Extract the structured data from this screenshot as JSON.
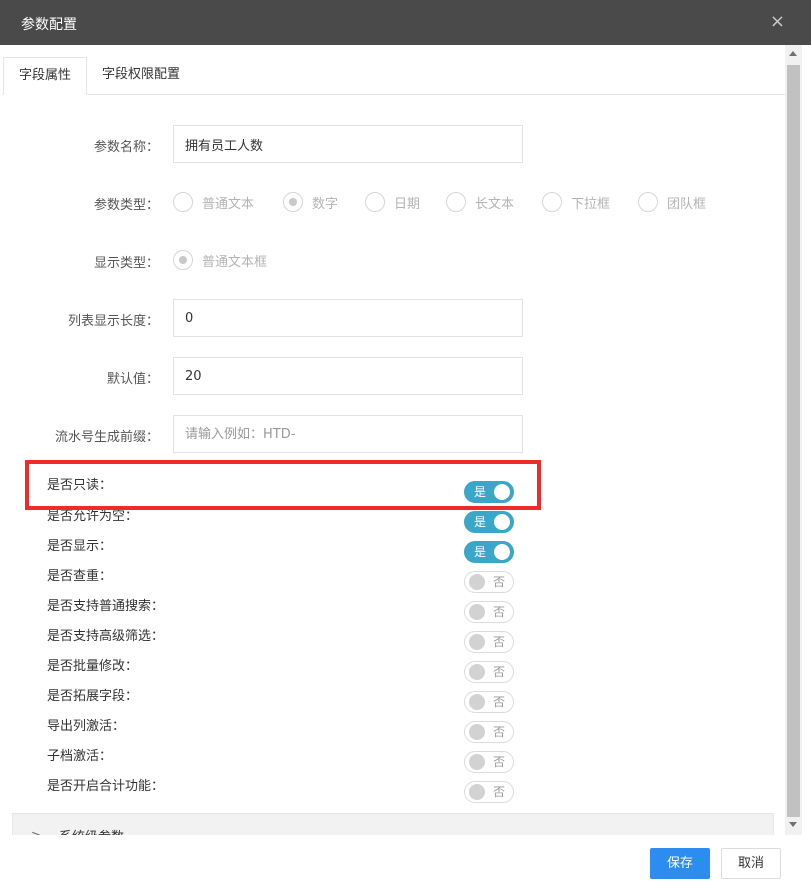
{
  "dialog": {
    "title": "参数配置",
    "close_label": "×"
  },
  "tabs": [
    {
      "label": "字段属性"
    },
    {
      "label": "字段权限配置"
    }
  ],
  "form": {
    "param_name": {
      "label": "参数名称：",
      "value": "拥有员工人数"
    },
    "param_type": {
      "label": "参数类型：",
      "options": [
        "普通文本",
        "数字",
        "日期",
        "长文本",
        "下拉框",
        "团队框"
      ],
      "selected": "数字"
    },
    "display_type": {
      "label": "显示类型：",
      "options": [
        "普通文本框"
      ],
      "selected": "普通文本框"
    },
    "list_length": {
      "label": "列表显示长度：",
      "value": "0"
    },
    "default_value": {
      "label": "默认值：",
      "value": "20"
    },
    "serial_prefix": {
      "label": "流水号生成前缀：",
      "value": "",
      "placeholder": "请输入例如：HTD-"
    }
  },
  "switches": [
    {
      "label": "是否只读：",
      "state": "是"
    },
    {
      "label": "是否允许为空：",
      "state": "是"
    },
    {
      "label": "是否显示：",
      "state": "是"
    },
    {
      "label": "是否查重：",
      "state": "否"
    },
    {
      "label": "是否支持普通搜索：",
      "state": "否"
    },
    {
      "label": "是否支持高级筛选：",
      "state": "否"
    },
    {
      "label": "是否批量修改：",
      "state": "否"
    },
    {
      "label": "是否拓展字段：",
      "state": "否"
    },
    {
      "label": "导出列激活：",
      "state": "否"
    },
    {
      "label": "子档激活：",
      "state": "否"
    },
    {
      "label": "是否开启合计功能：",
      "state": "否"
    }
  ],
  "collapse": {
    "arrow": ">",
    "label": "系统级参数"
  },
  "footer": {
    "save_label": "保存",
    "cancel_label": "取消"
  },
  "colors": {
    "accent": "#2d8cf0",
    "switch_on": "#3aa6c8",
    "highlight": "#ee2b2b",
    "titlebar": "#4a4a4a"
  }
}
